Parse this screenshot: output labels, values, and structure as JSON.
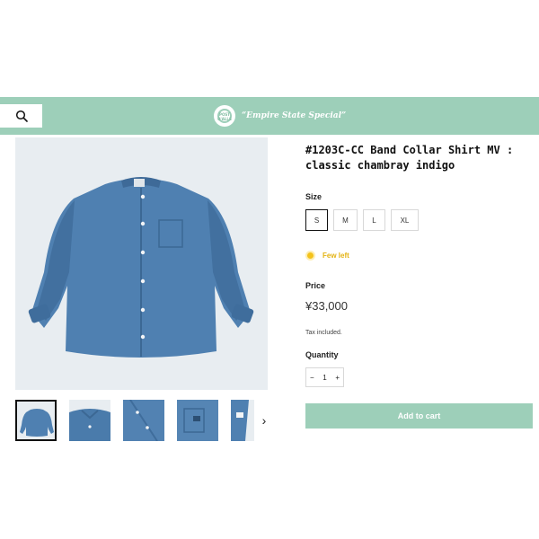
{
  "header": {
    "tagline": "“Empire State Special”",
    "logo_text": "POST O'ALLS",
    "background": "#9dcfb9"
  },
  "product": {
    "title": "#1203C-CC Band Collar Shirt MV : classic chambray indigo",
    "size_label": "Size",
    "sizes": [
      "S",
      "M",
      "L",
      "XL"
    ],
    "selected_size": "S",
    "stock_text": "Few left",
    "price_label": "Price",
    "price": "¥33,000",
    "tax_note": "Tax included.",
    "quantity_label": "Quantity",
    "quantity": "1",
    "qty_minus": "−",
    "qty_plus": "+",
    "add_to_cart": "Add to cart"
  },
  "gallery": {
    "thumbnail_count": 5,
    "next_icon": "›"
  },
  "colors": {
    "accent": "#9dcfb9",
    "stock": "#f4c21b",
    "shirt": "#4d7fb0"
  }
}
